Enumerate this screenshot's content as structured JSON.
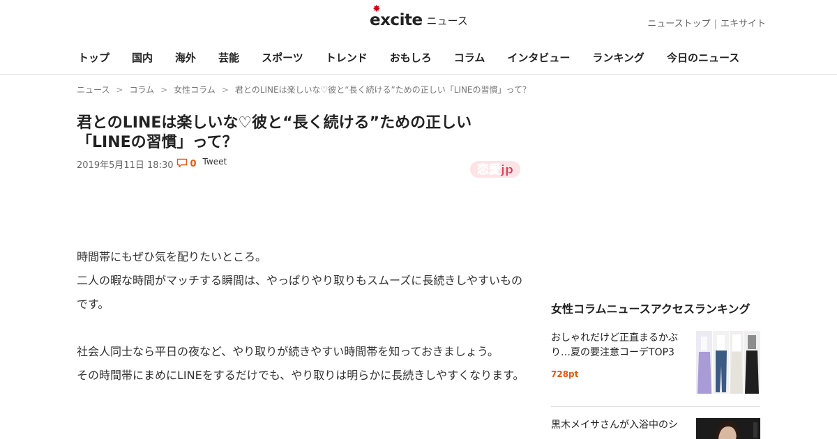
{
  "header": {
    "logo_text": "excite",
    "logo_sub": "ニュース",
    "top_links": [
      "ニューストップ",
      "エキサイト"
    ],
    "nav": [
      "トップ",
      "国内",
      "海外",
      "芸能",
      "スポーツ",
      "トレンド",
      "おもしろ",
      "コラム",
      "インタビュー",
      "ランキング",
      "今日のニュース"
    ]
  },
  "breadcrumb": [
    "ニュース",
    "コラム",
    "女性コラム",
    "君とのLINEは楽しいな♡彼と“長く続ける”ための正しい「LINEの習慣」って？"
  ],
  "article": {
    "title": "君とのLINEは楽しいな♡彼と“長く続ける”ための正しい「LINEの習慣」って？",
    "date": "2019年5月11日 18:30",
    "comment_count": "0",
    "tweet_label": "Tweet",
    "source_logo": "恋愛jp",
    "paragraphs": [
      "時間帯にもぜひ気を配りたいところ。",
      "二人の暇な時間がマッチする瞬間は、やっぱりやり取りもスムーズに長続きしやすいものです。",
      "",
      "社会人同士なら平日の夜など、やり取りが続きやすい時間帯を知っておきましょう。",
      "その時間帯にまめにLINEをするだけでも、やり取りは明らかに長続きしやすくなります。"
    ]
  },
  "ranking": {
    "title": "女性コラムニュースアクセスランキング",
    "items": [
      {
        "title": "おしゃれだけど正直まるかぶり…夏の要注意コーデTOP3",
        "points": "728pt"
      },
      {
        "title": "黒木メイサさんが入浴中のシ",
        "points": ""
      }
    ]
  },
  "colors": {
    "accent": "#e8590c",
    "logo_red": "#d0021b"
  }
}
